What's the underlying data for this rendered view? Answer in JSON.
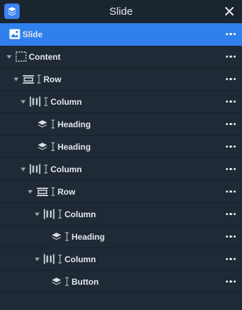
{
  "header": {
    "title": "Slide",
    "app_icon": "layers-icon",
    "close_icon": "close-icon"
  },
  "tree": [
    {
      "label": "Slide",
      "icon": "image-icon",
      "level": 0,
      "caret": false,
      "cursor": false,
      "selected": true
    },
    {
      "label": "Content",
      "icon": "dashed-box-icon",
      "level": 0,
      "caret": true,
      "cursor": false,
      "selected": false
    },
    {
      "label": "Row",
      "icon": "row-icon",
      "level": 1,
      "caret": true,
      "cursor": true,
      "selected": false
    },
    {
      "label": "Column",
      "icon": "column-icon",
      "level": 2,
      "caret": true,
      "cursor": true,
      "selected": false
    },
    {
      "label": "Heading",
      "icon": "layers-icon",
      "level": 3,
      "caret": false,
      "cursor": true,
      "selected": false
    },
    {
      "label": "Heading",
      "icon": "layers-icon",
      "level": 3,
      "caret": false,
      "cursor": true,
      "selected": false
    },
    {
      "label": "Column",
      "icon": "column-icon",
      "level": 2,
      "caret": true,
      "cursor": true,
      "selected": false
    },
    {
      "label": "Row",
      "icon": "row-icon",
      "level": 3,
      "caret": true,
      "cursor": true,
      "selected": false
    },
    {
      "label": "Column",
      "icon": "column-icon",
      "level": 4,
      "caret": true,
      "cursor": true,
      "selected": false
    },
    {
      "label": "Heading",
      "icon": "layers-icon",
      "level": 5,
      "caret": false,
      "cursor": true,
      "selected": false
    },
    {
      "label": "Column",
      "icon": "column-icon",
      "level": 4,
      "caret": true,
      "cursor": true,
      "selected": false
    },
    {
      "label": "Button",
      "icon": "layers-icon",
      "level": 5,
      "caret": false,
      "cursor": true,
      "selected": false
    }
  ],
  "colors": {
    "background": "#1f2a36",
    "header": "#1b252f",
    "selected": "#2f80ed",
    "text": "#e3e8ee"
  }
}
